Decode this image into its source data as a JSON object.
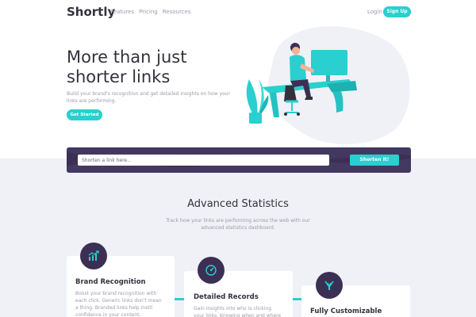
{
  "brand": {
    "logo": "Shortly"
  },
  "nav": {
    "links": [
      "Features",
      "Pricing",
      "Resources"
    ],
    "login": "Login",
    "signup": "Sign Up"
  },
  "hero": {
    "title": "More than just shorter links",
    "subtitle": "Build your brand's recognition and get detailed insights on how your links are performing.",
    "cta": "Get Started",
    "illustration": "person-working-at-desk-illustration"
  },
  "shorten": {
    "placeholder": "Shorten a link here...",
    "button": "Shorten It!"
  },
  "stats": {
    "title": "Advanced Statistics",
    "subtitle": "Track how your links are performing across the web with our advanced statistics dashboard.",
    "cards": [
      {
        "icon": "chart-icon",
        "title": "Brand Recognition",
        "text": "Boost your brand recognition with each click. Generic links don't mean a thing. Branded links help instil confidence in your content."
      },
      {
        "icon": "gauge-icon",
        "title": "Detailed Records",
        "text": "Gain insights into who is clicking your links. Knowing when and where"
      },
      {
        "icon": "brush-icon",
        "title": "Fully Customizable",
        "text": ""
      }
    ]
  },
  "colors": {
    "primary": "#2acfcf",
    "dark_violet": "#3b3054",
    "gray": "#9e9aa8",
    "dark": "#34313d",
    "light_bg": "#eff1f7"
  }
}
